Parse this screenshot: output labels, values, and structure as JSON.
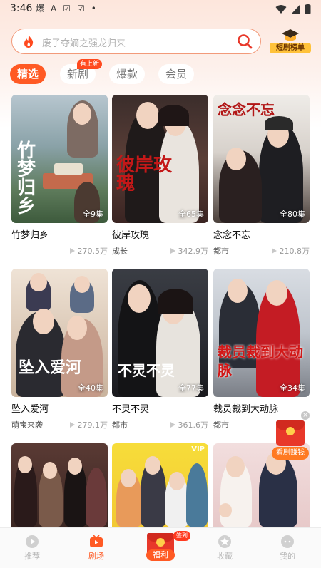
{
  "status_bar": {
    "time": "3:46",
    "icons": [
      "爆",
      "A",
      "☑",
      "☑",
      "•"
    ]
  },
  "search": {
    "placeholder": "废子夺嫡之强龙归来",
    "rank_label": "短剧榜单"
  },
  "tabs": [
    {
      "label": "精选",
      "active": true
    },
    {
      "label": "新剧",
      "active": false,
      "badge": "有上新"
    },
    {
      "label": "爆款",
      "active": false
    },
    {
      "label": "会员",
      "active": false
    }
  ],
  "cards": [
    {
      "title": "竹梦归乡",
      "episodes": "全9集",
      "tag": "",
      "views": "270.5万",
      "poster_title": "竹梦归乡"
    },
    {
      "title": "彼岸玫瑰",
      "episodes": "全65集",
      "tag": "成长",
      "views": "342.9万",
      "poster_title": "彼岸玫瑰"
    },
    {
      "title": "念念不忘",
      "episodes": "全80集",
      "tag": "都市",
      "views": "210.8万",
      "poster_title": "念念不忘"
    },
    {
      "title": "坠入爱河",
      "episodes": "全40集",
      "tag": "萌宝来袭",
      "views": "279.1万",
      "poster_title": "坠入爱河"
    },
    {
      "title": "不灵不灵",
      "episodes": "全77集",
      "tag": "都市",
      "views": "361.6万",
      "poster_title": "不灵不灵"
    },
    {
      "title": "裁员裁到大动脉",
      "episodes": "全34集",
      "tag": "都市",
      "views": "",
      "poster_title": "裁员裁到大动脉"
    },
    {
      "title": "",
      "episodes": "",
      "tag": "",
      "views": "",
      "poster_title": ""
    },
    {
      "title": "",
      "episodes": "",
      "tag": "",
      "views": "",
      "poster_title": "",
      "vip": "VIP"
    },
    {
      "title": "",
      "episodes": "",
      "tag": "",
      "views": "",
      "poster_title": ""
    }
  ],
  "floating_reward": {
    "label": "看剧赚钱",
    "close": "×"
  },
  "bottom_nav": [
    {
      "label": "推荐",
      "icon": "play-circle-icon",
      "active": false
    },
    {
      "label": "剧场",
      "icon": "tv-icon",
      "active": true
    },
    {
      "label": "福利",
      "icon": "red-envelope-icon",
      "active": false,
      "badge": "签到"
    },
    {
      "label": "收藏",
      "icon": "star-icon",
      "active": false
    },
    {
      "label": "我的",
      "icon": "profile-icon",
      "active": false
    }
  ],
  "colors": {
    "accent": "#ff5a24",
    "search_border": "#f29a7a",
    "header_gradient_top": "#fde6dc"
  }
}
